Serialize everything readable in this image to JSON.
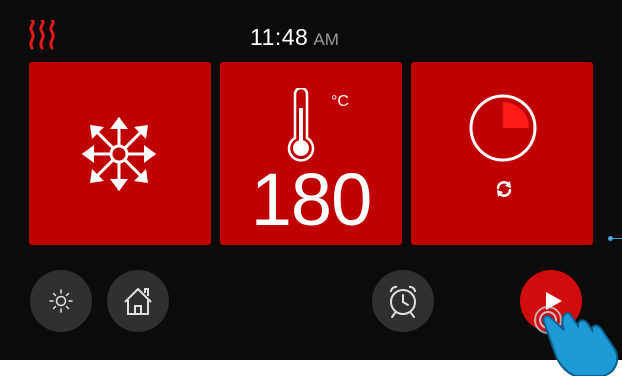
{
  "status_bar": {
    "time": "11:48",
    "ampm": "AM",
    "heat_icon": "heat-waves-icon"
  },
  "tiles": {
    "fan": {
      "icon": "fan-snowflake-icon"
    },
    "temperature": {
      "icon": "thermometer-icon",
      "unit": "°C",
      "value": "180"
    },
    "timer": {
      "icon": "timer-dial-icon",
      "secondary_icon": "sync-icon"
    }
  },
  "bottom_bar": {
    "buttons": [
      "light-icon",
      "home-icon",
      "alarm-clock-icon",
      "play-icon"
    ]
  },
  "colors": {
    "background": "#0b0b0b",
    "tile": "#c00000",
    "button": "#303030",
    "play": "#d10c0c",
    "accent": "#4fa3d9"
  }
}
